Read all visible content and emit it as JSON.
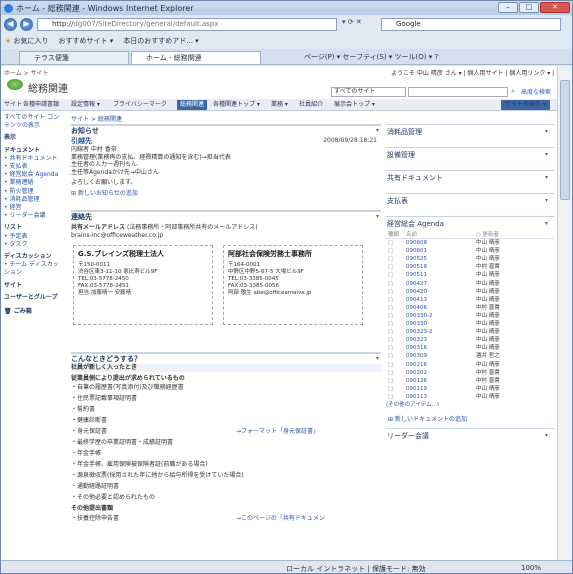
{
  "window": {
    "title": "ホーム - 総務関連 - Windows Internet Explorer",
    "min": "–",
    "max": "□",
    "close": "✕"
  },
  "address": {
    "url_a": "http://",
    "url_b": "dg007/SiteDirectory/general/default.aspx",
    "search_engine": "Google"
  },
  "favorites": {
    "label": "お気に入り",
    "item1": "おすすめサイト ▾",
    "item2": "本日のおすすめアド... ▾"
  },
  "tabs": {
    "tab1": "テラス便箋",
    "tab2": "ホーム - 総務関連",
    "tools": "ページ(P) ▾  セーフティ(S) ▾  ツール(O) ▾  ?"
  },
  "header": {
    "crumb": "ホーム > サイト",
    "welcome": "ようこそ 中山 晴彦 さん ▾ | 個人用サイト | 個人用リンク ▾ | ?",
    "site_title": "総務関連",
    "scope": "すべてのサイト",
    "advanced": "高度な検索",
    "nav": [
      "サイト",
      "各種申請書類",
      "設定情報 ▾",
      "ブライバシーマーク",
      "総務関連",
      "各種関連トップ ▾",
      "業務 ▾",
      "社員紹介",
      "展示会トップ ▾"
    ],
    "site_button": "サイトの操作 ▾"
  },
  "left": {
    "all": "すべてのサイト コンテンツの表示",
    "view_head": "表示",
    "doc_head": "ドキュメント",
    "docs": [
      "共有ドキュメント",
      "支払表",
      "経営総会 Agenda",
      "業務連絡",
      "防火管理",
      "消耗品管理",
      "経営",
      "リーダー会議"
    ],
    "list_head": "リスト",
    "lists": [
      "予定表",
      "タスク"
    ],
    "disc_head": "ディスカッション",
    "discs": [
      "チーム ディスカッション"
    ],
    "site_head": "サイト",
    "users": "ユーザーとグループ",
    "trash": "ごみ箱"
  },
  "main": {
    "crumb": "サイト > 総務関連",
    "ann_head": "お知らせ",
    "ann_title": "引越先",
    "ann_date": "2008/09/28 18:21",
    "ann_lines": [
      "内線者 中村 香奈",
      "業務管理(業務再の支払、経費精算の通知を含む)→担当代表",
      "主任者の入力一週刊ちん",
      "主任等Agendaかけ先→中山さん"
    ],
    "ann_footer": "よろしくお願いします。",
    "ann_more": "新しいお知らせの追加",
    "contact_head": "連絡先",
    "contact_title": "共有メールアドレス",
    "contact_note": "(法務事務所・阿部事務所共有のメールアドレス)",
    "contact_email": "brains-inc@officeweather.co.jp",
    "card1": {
      "name": "G.S.ブレインズ税理士法人",
      "lines": [
        "〒150-0011",
        "渋谷区東3-11-10 恵比寿ビル9F",
        "",
        "TEL:03-5778-2450",
        "FAX:03-5778-2451",
        "",
        "担当:加藤晴一 安藤晴"
      ]
    },
    "card2": {
      "name": "阿部社会保険労務士事務所",
      "lines": [
        "〒164-0001",
        "中野区中野5-67-5 大場ビル9F",
        "",
        "TEL:03-3385-0045",
        "FAX:03-3385-0056",
        "",
        "阿部 敬生 abe@officeamaive.jp"
      ]
    },
    "how_head": "こんなときどうする？",
    "how_sub": "社員が新しく入ったとき",
    "how_bold": "従業員側により提出が求められているもの",
    "how_items": [
      "・自筆の履歴書(写真添付)及び職務経歴書",
      "・住民票記載事項証明書",
      "・誓約書",
      "・健康診断書",
      "・身元保証書",
      "・最終学歴の卒業証明書・成績証明書",
      "・年金手帳",
      "・年金手帳、雇用保険被保険者証(前職がある場合)",
      "・源泉徴収票(採用された年に他から給与所得を受けていた場合)",
      "・通勤経路証明書",
      "・その他必要と認められたもの"
    ],
    "how_link": "→フォーマット「身元保証書」",
    "how_bold2": "その他提出書類",
    "how_last": "・扶養控除申告書",
    "how_link2": "→このページの「共有ドキュメン"
  },
  "right": {
    "panels": [
      "消耗品管理",
      "設備管理",
      "共有ドキュメント",
      "支払表"
    ],
    "agenda_head": "経営総会 Agenda",
    "agenda_cols": [
      "種類",
      "名前",
      "○ 更新者"
    ],
    "agenda_rows": [
      [
        "□",
        "090608",
        "中山 晴彦"
      ],
      [
        "□",
        "090601",
        "中山 晴彦"
      ],
      [
        "□",
        "090525",
        "中山 晴彦"
      ],
      [
        "□",
        "090518",
        "中村 晋貴"
      ],
      [
        "□",
        "090511",
        "中山 晴彦"
      ],
      [
        "□",
        "090427",
        "中山 晴彦"
      ],
      [
        "□",
        "090420",
        "中山 晴彦"
      ],
      [
        "□",
        "090413",
        "中山 晴彦"
      ],
      [
        "□",
        "090406",
        "中村 晋貴"
      ],
      [
        "□",
        "090330-2",
        "中山 晴彦"
      ],
      [
        "□",
        "090330",
        "中山 晴彦"
      ],
      [
        "□",
        "090323-2",
        "中山 晴彦"
      ],
      [
        "□",
        "090323",
        "中山 晴彦"
      ],
      [
        "□",
        "090316",
        "中山 晴彦"
      ],
      [
        "□",
        "090309",
        "酒井 哲之"
      ],
      [
        "□",
        "090216",
        "中山 晴彦"
      ],
      [
        "□",
        "090202",
        "中村 晋貴"
      ],
      [
        "□",
        "090126",
        "中村 晋貴"
      ],
      [
        "□",
        "090119",
        "中山 晴彦"
      ],
      [
        "□",
        "090113",
        "中山 晴彦"
      ]
    ],
    "agenda_more": "(その他のアイテム...)",
    "agenda_add": "新しいドキュメントの追加",
    "leader": "リーダー会議"
  },
  "status": {
    "zone": "ローカル イントラネット | 保護モード: 無効",
    "zoom": "100%"
  }
}
